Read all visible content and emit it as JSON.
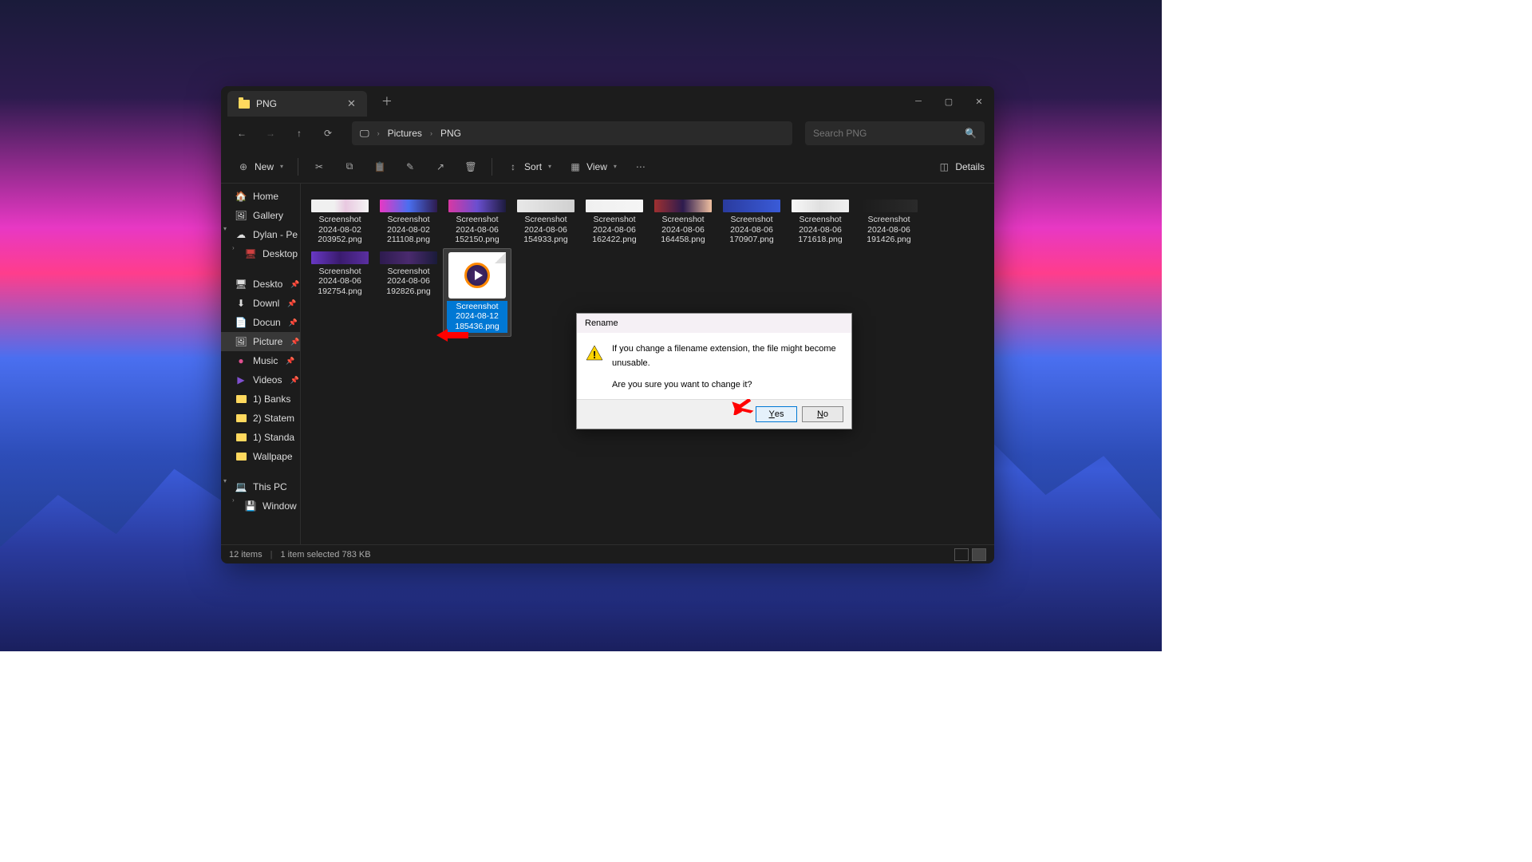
{
  "tab": {
    "title": "PNG"
  },
  "breadcrumb": {
    "items": [
      "Pictures",
      "PNG"
    ]
  },
  "search": {
    "placeholder": "Search PNG"
  },
  "toolbar": {
    "new_label": "New",
    "sort_label": "Sort",
    "view_label": "View",
    "details_label": "Details"
  },
  "sidebar": {
    "home": "Home",
    "gallery": "Gallery",
    "onedrive": "Dylan - Pe",
    "desktop_od": "Desktop",
    "desktop": "Deskto",
    "downloads": "Downl",
    "documents": "Docun",
    "pictures": "Picture",
    "music": "Music",
    "videos": "Videos",
    "f1": "1) Banks",
    "f2": "2) Statem",
    "f3": "1) Standa",
    "f4": "Wallpape",
    "thispc": "This PC",
    "windows": "Window"
  },
  "files": [
    {
      "name_l1": "Screenshot",
      "name_l2": "2024-08-02",
      "name_l3": "203952.png",
      "thumb": "linear-gradient(90deg,#f0f0f0 40%,#e8c8e0 60%,#f5f5f5)"
    },
    {
      "name_l1": "Screenshot",
      "name_l2": "2024-08-02",
      "name_l3": "211108.png",
      "thumb": "linear-gradient(90deg,#e838c4,#4a6ff0,#2d1b4e)"
    },
    {
      "name_l1": "Screenshot",
      "name_l2": "2024-08-06",
      "name_l3": "152150.png",
      "thumb": "linear-gradient(90deg,#d838a4,#6a4fd0,#1d1b3e)"
    },
    {
      "name_l1": "Screenshot",
      "name_l2": "2024-08-06",
      "name_l3": "154933.png",
      "thumb": "linear-gradient(90deg,#e8e8e8,#d0d0d0)"
    },
    {
      "name_l1": "Screenshot",
      "name_l2": "2024-08-06",
      "name_l3": "162422.png",
      "thumb": "linear-gradient(90deg,#f0f0f0,#f5f5f5)"
    },
    {
      "name_l1": "Screenshot",
      "name_l2": "2024-08-06",
      "name_l3": "164458.png",
      "thumb": "linear-gradient(90deg,#a03030,#2d1b4e,#f0c0a0)"
    },
    {
      "name_l1": "Screenshot",
      "name_l2": "2024-08-06",
      "name_l3": "170907.png",
      "thumb": "linear-gradient(90deg,#2a3b9e,#3a5bd8)"
    },
    {
      "name_l1": "Screenshot",
      "name_l2": "2024-08-06",
      "name_l3": "171618.png",
      "thumb": "linear-gradient(90deg,#f8f8f8,#e0e0e0,#f0f0f0)"
    },
    {
      "name_l1": "Screenshot",
      "name_l2": "2024-08-06",
      "name_l3": "191426.png",
      "thumb": "linear-gradient(90deg,#1c1c1c,#2a2a2a)"
    },
    {
      "name_l1": "Screenshot",
      "name_l2": "2024-08-06",
      "name_l3": "192754.png",
      "thumb": "linear-gradient(90deg,#6838c4,#3a1b6e,#5a2fa0)"
    },
    {
      "name_l1": "Screenshot",
      "name_l2": "2024-08-06",
      "name_l3": "192826.png",
      "thumb": "linear-gradient(90deg,#2d1b4e,#4a2a6e,#1a1b3a)"
    }
  ],
  "selected_file": {
    "name": "Screenshot 2024-08-12 185436.png"
  },
  "statusbar": {
    "count": "12 items",
    "selection": "1 item selected  783 KB"
  },
  "dialog": {
    "title": "Rename",
    "line1": "If you change a filename extension, the file might become unusable.",
    "line2": "Are you sure you want to change it?",
    "yes": "Yes",
    "no": "No"
  }
}
